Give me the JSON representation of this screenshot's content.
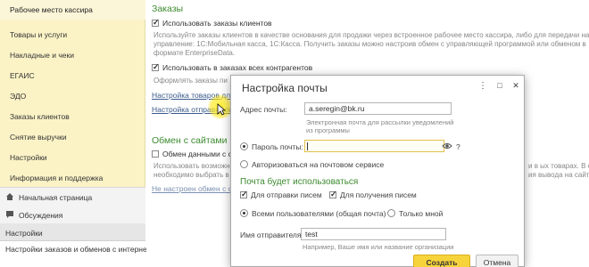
{
  "sidebar": {
    "items": [
      {
        "label": "Рабочее место кассира"
      },
      {
        "label": "Товары и услуги"
      },
      {
        "label": "Накладные и чеки"
      },
      {
        "label": "ЕГАИС"
      },
      {
        "label": "ЭДО"
      },
      {
        "label": "Заказы клиентов"
      },
      {
        "label": "Снятие выручки"
      },
      {
        "label": "Настройки"
      },
      {
        "label": "Информация и поддержка"
      }
    ],
    "bottom": {
      "home": "Начальная страница",
      "discussions": "Обсуждения",
      "settings": "Настройки",
      "current_page": "Настройки заказов и обменов с интернет-магазинами"
    }
  },
  "main": {
    "orders": {
      "title": "Заказы",
      "use_orders_label": "Использовать заказы клиентов",
      "use_orders_note_1": "Используйте заказы клиентов в качестве основания для продажи через встроенное рабочее место кассира, либо для передачи на",
      "use_orders_note_2": "управление: 1С:Мобильная касса, 1С:Касса. Получить заказы можно настроив обмен с управляющей программой или обменом в",
      "use_orders_note_3": "формате EnterpriseData.",
      "all_contractors_label": "Использовать в заказах всех контрагентов",
      "all_contractors_note": "Оформлять заказы пи",
      "link_goods": "Настройка товаров для",
      "link_sending": "Настройка отправки писе"
    },
    "exchange": {
      "title": "Обмен с сайтами",
      "exchange_label": "Обмен данными с сай",
      "exchange_note_1": "Использовать возможнос",
      "exchange_note_2": "необходимо выбрать в",
      "exchange_note_right_1": "и в ых товарах. В спи",
      "exchange_note_right_2": "ия вывода на сайт",
      "not_configured_link": "Не настроен обмен с сай"
    }
  },
  "dialog": {
    "title": "Настройка почты",
    "address_label": "Адрес почты:",
    "address_value": "a.seregin@bk.ru",
    "address_hint": "Электронная почта для рассылки уведомлений из программы",
    "password_radio_label": "Пароль почты:",
    "password_value": "",
    "help_mark": "?",
    "auth_radio_label": "Авторизоваться на почтовом сервисе",
    "usage_title": "Почта будет использоваться",
    "send_label": "Для отправки писем",
    "receive_label": "Для получения писем",
    "all_users_label": "Всеми пользователями (общая почта)",
    "only_me_label": "Только мной",
    "sender_label": "Имя отправителя:",
    "sender_value": "test",
    "sender_hint": "Например, Ваше имя или название организации",
    "create_button": "Создать",
    "cancel_button": "Отмена",
    "menu_glyph": "⋮",
    "maximize_glyph": "□",
    "close_glyph": "✕"
  },
  "colors": {
    "sidebar_bg": "#fbf3c6",
    "section_title": "#3c8b2f",
    "link": "#3a5a8a",
    "primary_button": "#f7d33b"
  }
}
